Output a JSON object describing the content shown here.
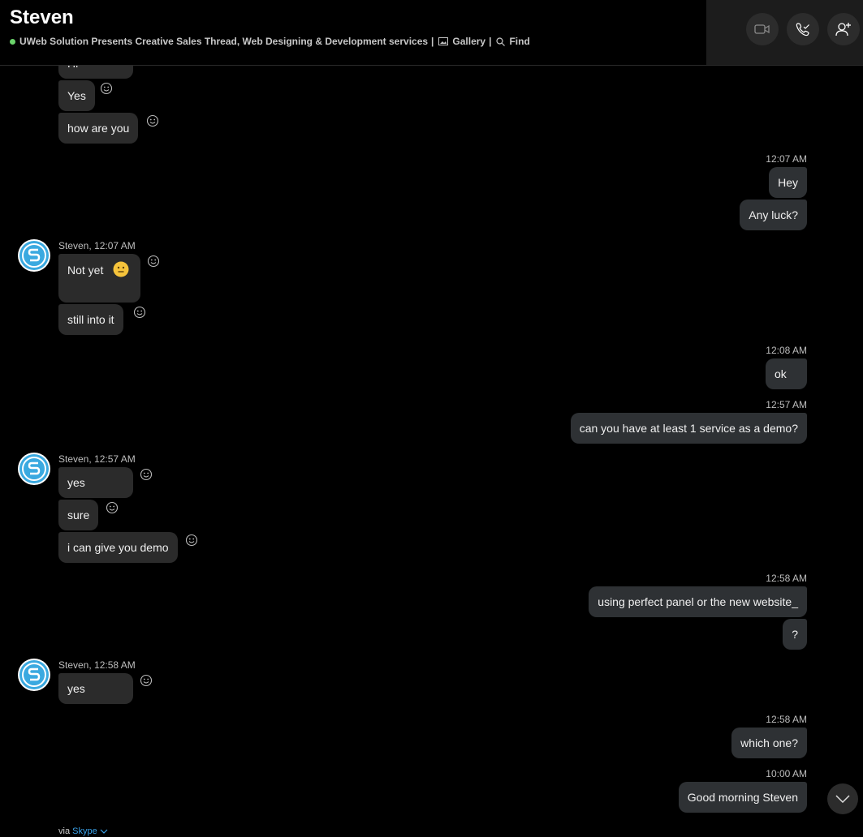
{
  "header": {
    "contact_name": "Steven",
    "status_text": "UWeb Solution Presents Creative Sales Thread, Web Designing & Development services",
    "separator": "|",
    "gallery_label": "Gallery",
    "find_label": "Find",
    "status_color": "#6bd46b"
  },
  "messages": {
    "in1": {
      "partial": "Hi",
      "yes": "Yes",
      "how": "how are you"
    },
    "out1": {
      "time": "12:07 AM",
      "hey": "Hey",
      "luck": "Any luck?"
    },
    "in2": {
      "sender": "Steven, 12:07 AM",
      "notyet": "Not yet",
      "still": "still into it"
    },
    "out2": {
      "time": "12:08 AM",
      "ok": "ok"
    },
    "out3": {
      "time": "12:57 AM",
      "demo": "can you have at least 1 service as a demo?"
    },
    "in3": {
      "sender": "Steven, 12:57 AM",
      "yes": "yes",
      "sure": "sure",
      "give": "i can give you demo"
    },
    "out4": {
      "time": "12:58 AM",
      "perfect": "using perfect panel or the new website_",
      "q": "?"
    },
    "in4": {
      "sender": "Steven, 12:58 AM",
      "yes": "yes"
    },
    "out5": {
      "time": "12:58 AM",
      "which": "which one?"
    },
    "out6": {
      "time": "10:00 AM",
      "morning": "Good morning Steven"
    }
  },
  "footer": {
    "via": "via",
    "skype": "Skype"
  },
  "colors": {
    "accent": "#3aa1e8",
    "bubble_in": "#2b2b2b",
    "bubble_out": "#2e3134",
    "background": "#000000"
  },
  "icons": [
    "video-call-icon",
    "audio-call-icon",
    "add-people-icon",
    "gallery-icon",
    "search-icon",
    "emoji-reaction-icon",
    "chevron-down-icon",
    "neutral-face-emoji"
  ]
}
